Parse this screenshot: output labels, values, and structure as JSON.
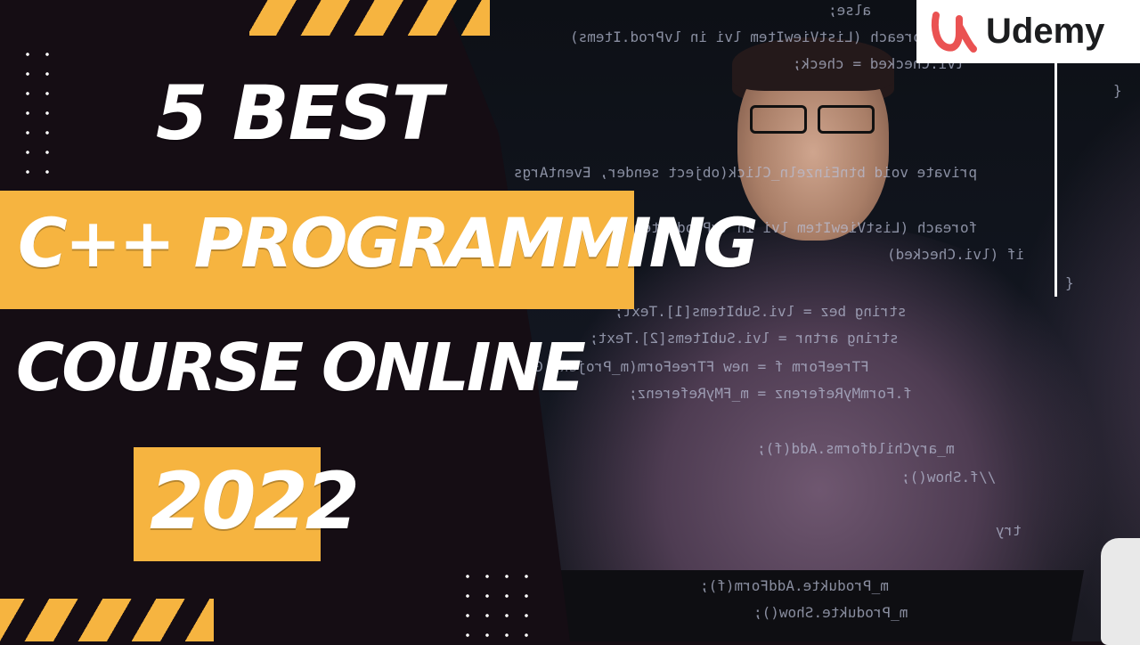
{
  "headline": {
    "line1": "5 BEST",
    "line2": "C++ PROGRAMMING",
    "line3": "COURSE ONLINE",
    "line4": "2022"
  },
  "brand": {
    "logo_text": "Udemy",
    "logo_color": "#ea5252"
  },
  "code_lines": [
    "alse;",
    "foreach (ListViewItem lvi in lvProd.Items)",
    "lvi.Checked = check;",
    "{",
    "private void btnEinzeln_Click(object sender, EventArgs e)",
    "foreach (ListViewItem lvi in lvProd.Item",
    "if (lvi.Checked)",
    "{",
    "string bez = lvi.SubItems[1].Text;",
    "string artnr = lvi.SubItems[2].Text;",
    "FTreeForm f = new FTreeForm(m_Projekt.GetPro",
    "f.FormMyReferenz = m_FMyReferenz;",
    "m_aryChildforms.Add(f);",
    "//f.Show();",
    "try",
    "m_Produkte.AddForm(f);",
    "m_Produkte.Show();"
  ],
  "colors": {
    "accent": "#f6b440",
    "background": "#150d14",
    "text": "#ffffff"
  }
}
